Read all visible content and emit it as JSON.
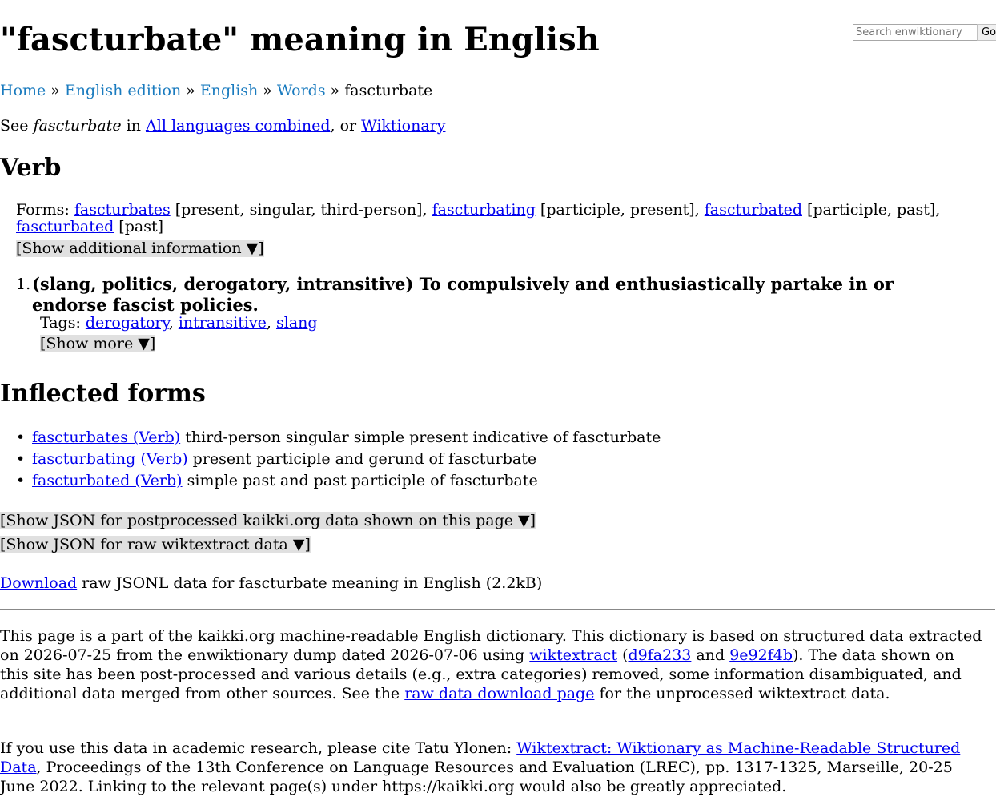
{
  "title": "\"fascturbate\" meaning in English",
  "search": {
    "placeholder": "Search enwiktionary",
    "button": "Go"
  },
  "breadcrumb": {
    "items": [
      "Home",
      "English edition",
      "English",
      "Words"
    ],
    "current": "fascturbate",
    "separator": "»"
  },
  "see": {
    "prefix": "See ",
    "word": "fascturbate",
    "mid": " in ",
    "link1": "All languages combined",
    "or": ", or ",
    "link2": "Wiktionary"
  },
  "pos": "Verb",
  "forms": {
    "label": "Forms: ",
    "items": [
      {
        "word": "fascturbates",
        "tags": " [present, singular, third-person], "
      },
      {
        "word": "fascturbating",
        "tags": " [participle, present], "
      },
      {
        "word": "fascturbated",
        "tags": " [participle, past], "
      },
      {
        "word": "fascturbated",
        "tags": " [past]"
      }
    ]
  },
  "show_additional": "[Show additional information ▼]",
  "sense": {
    "number": "1.",
    "gloss": "(slang, politics, derogatory, intransitive) To compulsively and enthusiastically partake in or endorse fascist policies.",
    "tags_label": "Tags: ",
    "tags": [
      "derogatory",
      "intransitive",
      "slang"
    ],
    "show_more": "[Show more ▼]"
  },
  "inflected": {
    "heading": "Inflected forms",
    "items": [
      {
        "link": "fascturbates (Verb)",
        "desc": " third-person singular simple present indicative of fascturbate"
      },
      {
        "link": "fascturbating (Verb)",
        "desc": " present participle and gerund of fascturbate"
      },
      {
        "link": "fascturbated (Verb)",
        "desc": " simple past and past participle of fascturbate"
      }
    ]
  },
  "json_toggles": {
    "postprocessed": "[Show JSON for postprocessed kaikki.org data shown on this page ▼]",
    "raw": "[Show JSON for raw wiktextract data ▼]"
  },
  "download": {
    "link": "Download",
    "text": " raw JSONL data for fascturbate meaning in English (2.2kB)"
  },
  "footer": {
    "p1_a": "This page is a part of the kaikki.org machine-readable English dictionary. This dictionary is based on structured data extracted on 2026-07-25 from the enwiktionary dump dated 2026-07-06 using ",
    "p1_link1": "wiktextract",
    "p1_b": " (",
    "p1_link2": "d9fa233",
    "p1_c": " and ",
    "p1_link3": "9e92f4b",
    "p1_d": "). The data shown on this site has been post-processed and various details (e.g., extra categories) removed, some information disambiguated, and additional data merged from other sources. See the ",
    "p1_link4": "raw data download page",
    "p1_e": " for the unprocessed wiktextract data.",
    "p2_a": "If you use this data in academic research, please cite Tatu Ylonen: ",
    "p2_link": "Wiktextract: Wiktionary as Machine-Readable Structured Data",
    "p2_b": ", Proceedings of the 13th Conference on Language Resources and Evaluation (LREC), pp. 1317-1325, Marseille, 20-25 June 2022. Linking to the relevant page(s) under https://kaikki.org would also be greatly appreciated."
  }
}
